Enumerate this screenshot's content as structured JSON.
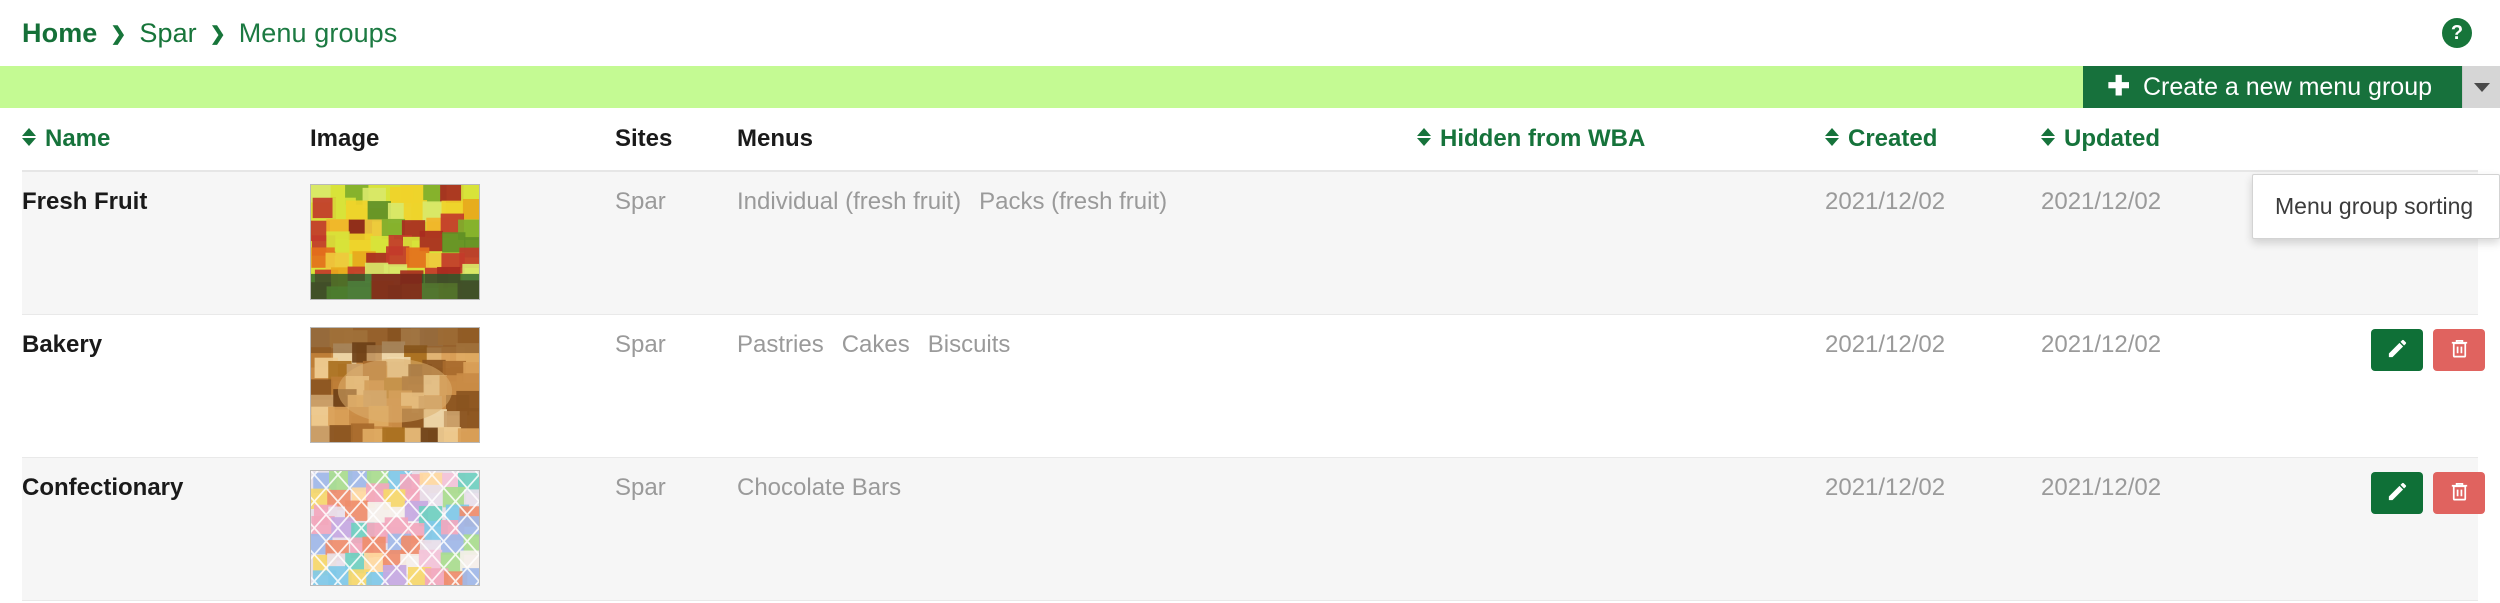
{
  "breadcrumb": {
    "items": [
      {
        "label": "Home",
        "current": false
      },
      {
        "label": "Spar",
        "current": false
      },
      {
        "label": "Menu groups",
        "current": true
      }
    ],
    "separator": "❯",
    "help_icon": "?"
  },
  "toolbar": {
    "create_label": "Create a new menu group",
    "plus_icon": "✚",
    "caret_icon": "caret-down-icon",
    "banner_color": "#c4fa93",
    "button_color": "#17713c"
  },
  "dropdown": {
    "open": true,
    "items": [
      {
        "label": "Menu group sorting"
      }
    ]
  },
  "table": {
    "columns": [
      {
        "key": "name",
        "label": "Name",
        "sortable": true,
        "accent": true
      },
      {
        "key": "image",
        "label": "Image",
        "sortable": false,
        "accent": false
      },
      {
        "key": "sites",
        "label": "Sites",
        "sortable": false,
        "accent": false
      },
      {
        "key": "menus",
        "label": "Menus",
        "sortable": false,
        "accent": false
      },
      {
        "key": "hidden",
        "label": "Hidden from WBA",
        "sortable": true,
        "accent": true
      },
      {
        "key": "created",
        "label": "Created",
        "sortable": true,
        "accent": true
      },
      {
        "key": "updated",
        "label": "Updated",
        "sortable": true,
        "accent": true
      },
      {
        "key": "actions",
        "label": "",
        "sortable": false,
        "accent": false
      }
    ],
    "rows": [
      {
        "name": "Fresh Fruit",
        "image_alt": "fresh-fruit-market-stall",
        "sites": "Spar",
        "menus": [
          "Individual (fresh fruit)",
          "Packs (fresh fruit)"
        ],
        "hidden": "",
        "created": "2021/12/02",
        "updated": "2021/12/02",
        "edit_label": "edit-icon",
        "delete_label": "trash-icon"
      },
      {
        "name": "Bakery",
        "image_alt": "assorted-bread-loaves",
        "sites": "Spar",
        "menus": [
          "Pastries",
          "Cakes",
          "Biscuits"
        ],
        "hidden": "",
        "created": "2021/12/02",
        "updated": "2021/12/02",
        "edit_label": "edit-icon",
        "delete_label": "trash-icon"
      },
      {
        "name": "Confectionary",
        "image_alt": "pick-and-mix-sweets-trays",
        "sites": "Spar",
        "menus": [
          "Chocolate Bars"
        ],
        "hidden": "",
        "created": "2021/12/02",
        "updated": "2021/12/02",
        "edit_label": "edit-icon",
        "delete_label": "trash-icon"
      }
    ]
  },
  "colors": {
    "brand_green": "#17753a",
    "banner_green": "#c4fa93",
    "edit_green": "#0f7037",
    "delete_red": "#e0635f",
    "muted_text": "#9a9a9a"
  }
}
